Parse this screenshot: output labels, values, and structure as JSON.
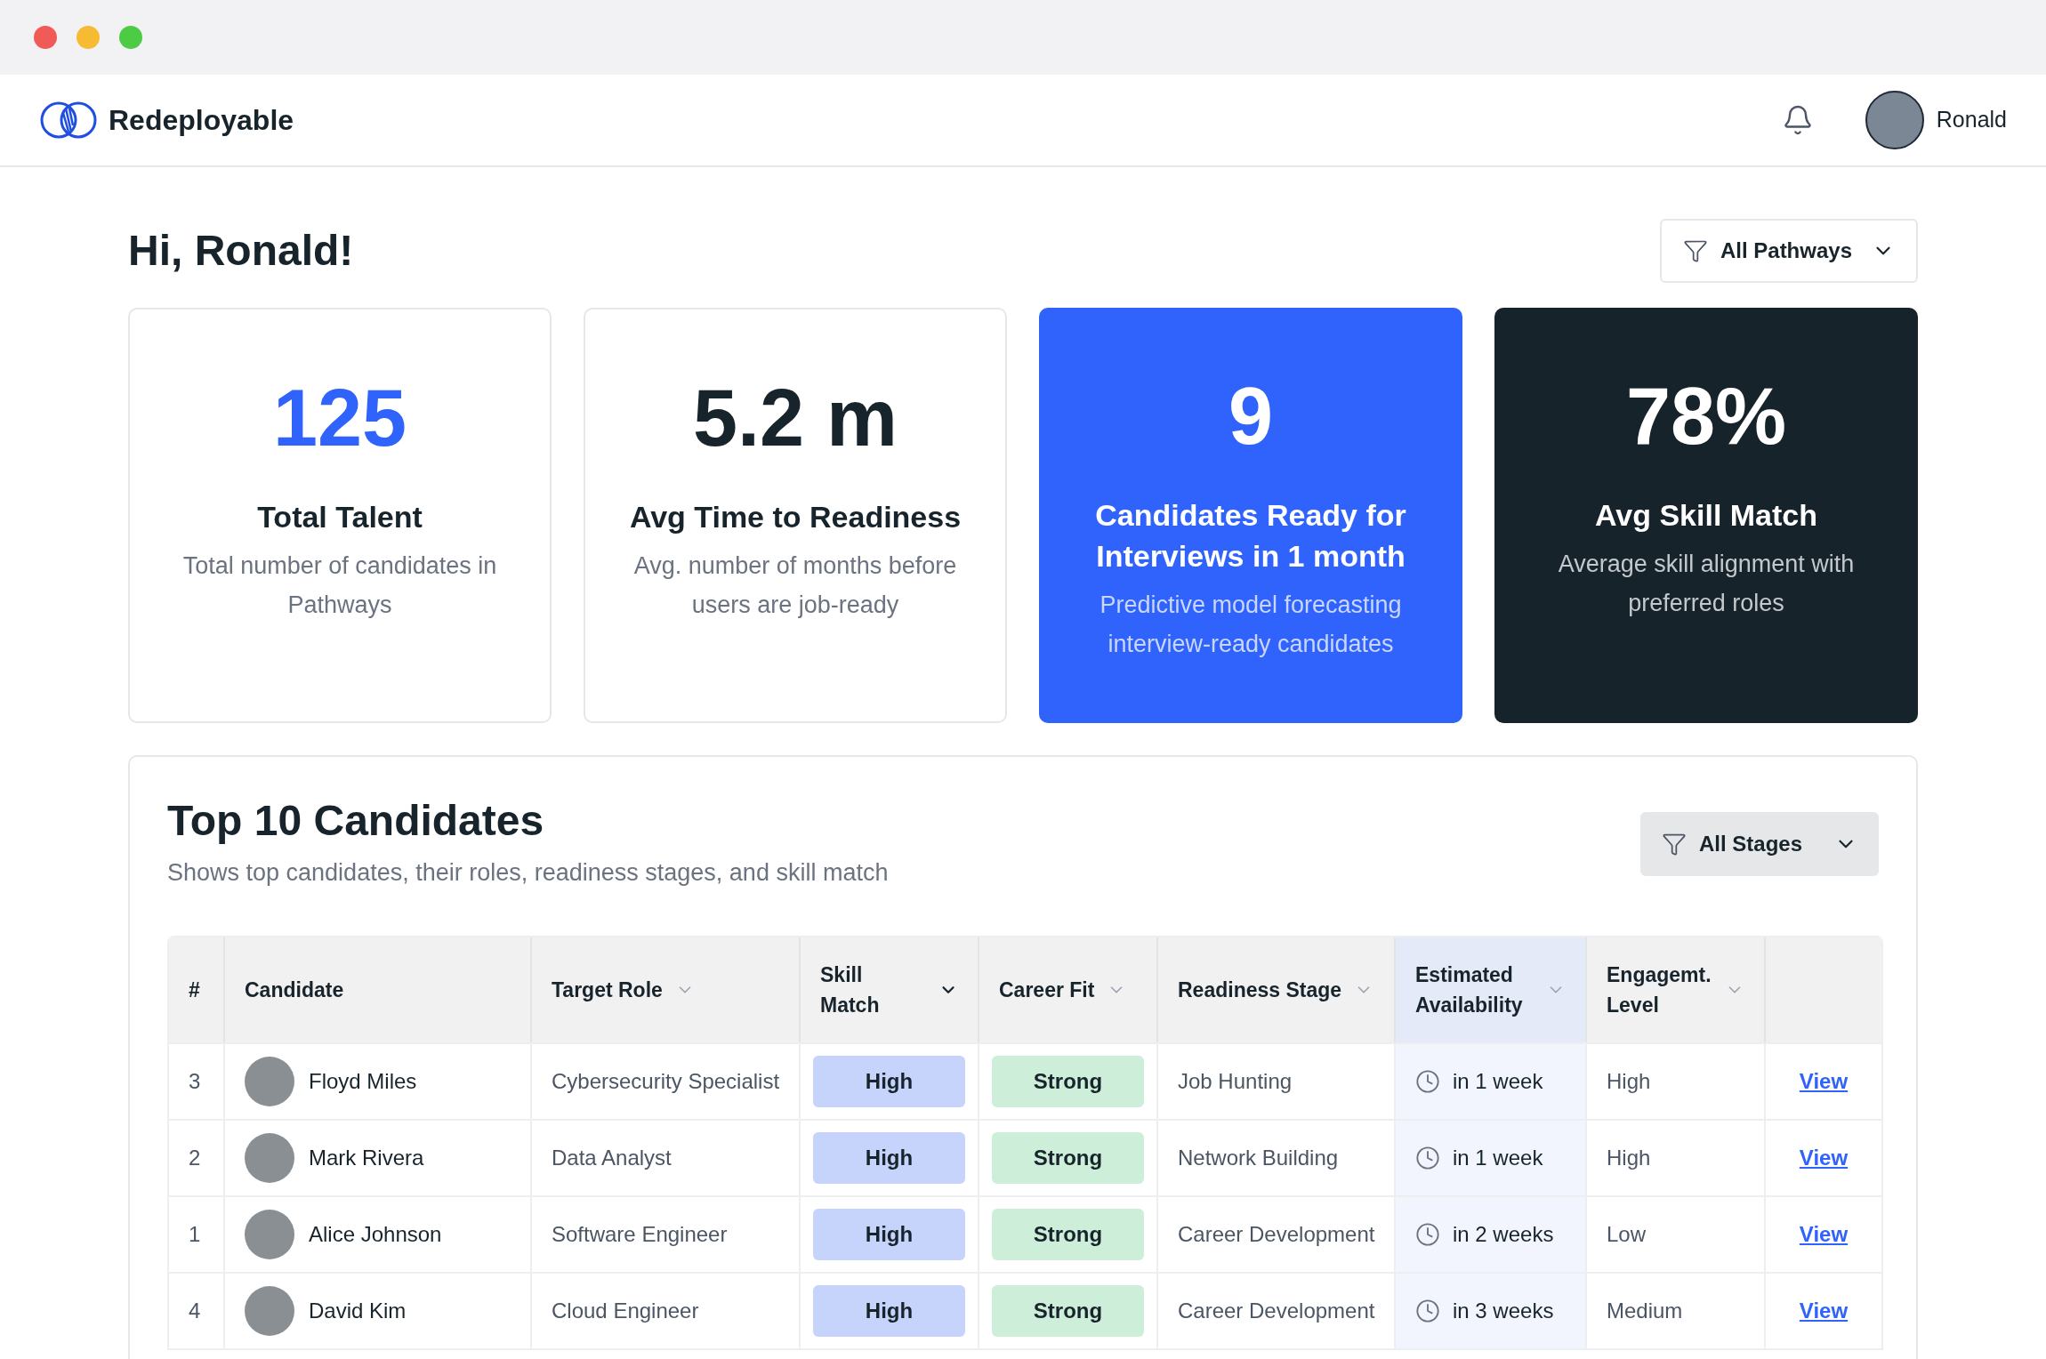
{
  "app": {
    "name": "Redeployable"
  },
  "user": {
    "name": "Ronald"
  },
  "greeting": "Hi, Ronald!",
  "pathway_filter": {
    "label": "All Pathways"
  },
  "stats": [
    {
      "kind": "plain",
      "value": "125",
      "title": "Total Talent",
      "description": "Total number of candidates in Pathways",
      "accent": true
    },
    {
      "kind": "plain",
      "value": "5.2 m",
      "title": "Avg Time to Readiness",
      "description": "Avg. number of months before users are job-ready",
      "accent": false
    },
    {
      "kind": "blue",
      "value": "9",
      "title": "Candidates Ready for Interviews in 1 month",
      "description": "Predictive model forecasting interview-ready candidates",
      "accent": false
    },
    {
      "kind": "dark",
      "value": "78%",
      "title": "Avg Skill Match",
      "description": "Average skill alignment with preferred roles",
      "accent": false
    }
  ],
  "candidates": {
    "title": "Top 10 Candidates",
    "subtitle": "Shows top candidates, their roles, readiness stages, and skill match",
    "stage_filter": {
      "label": "All Stages"
    },
    "columns": [
      {
        "label": "#",
        "kind": "plain",
        "highlighted": false
      },
      {
        "label": "Candidate",
        "kind": "plain",
        "highlighted": false
      },
      {
        "label": "Target Role",
        "kind": "sortable",
        "highlighted": false
      },
      {
        "label": "Skill Match",
        "kind": "sorted",
        "highlighted": false
      },
      {
        "label": "Career Fit",
        "kind": "sortable",
        "highlighted": false
      },
      {
        "label": "Readiness Stage",
        "kind": "sortable",
        "highlighted": false
      },
      {
        "label": "Estimated Availability",
        "kind": "sortable",
        "highlighted": true
      },
      {
        "label": "Engagemt. Level",
        "kind": "sortable",
        "highlighted": false
      }
    ],
    "rows": [
      {
        "rank": "3",
        "name": "Floyd Miles",
        "role": "Cybersecurity Specialist",
        "skill_match": "High",
        "career_fit": "Strong",
        "stage": "Job Hunting",
        "availability": "in 1 week",
        "engagement": "High",
        "action": "View"
      },
      {
        "rank": "2",
        "name": "Mark Rivera",
        "role": "Data Analyst",
        "skill_match": "High",
        "career_fit": "Strong",
        "stage": "Network Building",
        "availability": "in 1 week",
        "engagement": "High",
        "action": "View"
      },
      {
        "rank": "1",
        "name": "Alice Johnson",
        "role": "Software Engineer",
        "skill_match": "High",
        "career_fit": "Strong",
        "stage": "Career Development",
        "availability": "in 2 weeks",
        "engagement": "Low",
        "action": "View"
      },
      {
        "rank": "4",
        "name": "David Kim",
        "role": "Cloud Engineer",
        "skill_match": "High",
        "career_fit": "Strong",
        "stage": "Career Development",
        "availability": "in 3 weeks",
        "engagement": "Medium",
        "action": "View"
      }
    ]
  }
}
